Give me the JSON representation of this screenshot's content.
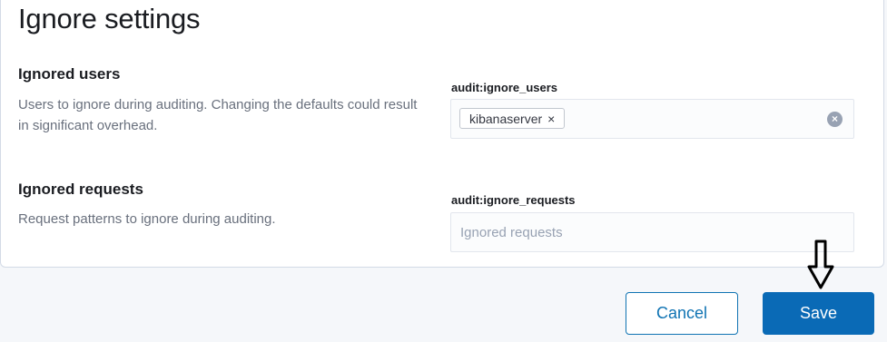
{
  "panel": {
    "title": "Ignore settings"
  },
  "ignored_users": {
    "title": "Ignored users",
    "description": "Users to ignore during auditing. Changing the defaults could result in significant overhead.",
    "field_label": "audit:ignore_users",
    "chips": [
      "kibanaserver"
    ],
    "chip_remove_glyph": "×",
    "clear_glyph": "×"
  },
  "ignored_requests": {
    "title": "Ignored requests",
    "description": "Request patterns to ignore during auditing.",
    "field_label": "audit:ignore_requests",
    "value": "",
    "placeholder": "Ignored requests"
  },
  "footer": {
    "cancel_label": "Cancel",
    "save_label": "Save"
  },
  "colors": {
    "primary": "#0a6ab6",
    "annotation_arrow": "#000000"
  },
  "icons": {
    "chip_remove": "cross-icon",
    "clear_all": "clear-circle-icon",
    "annotation": "down-arrow-icon"
  }
}
